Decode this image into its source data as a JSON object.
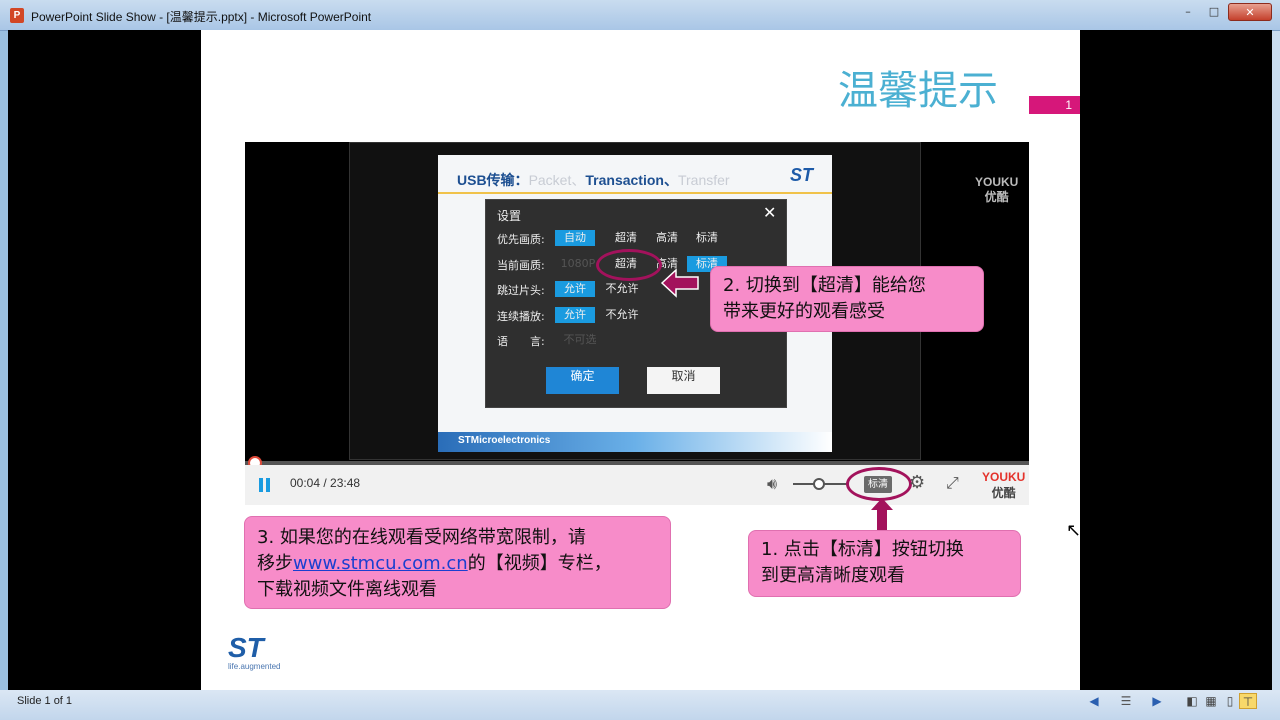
{
  "window": {
    "title": "PowerPoint Slide Show - [温馨提示.pptx] - Microsoft PowerPoint",
    "app_icon": "P",
    "minimize": "–",
    "maximize": "□",
    "close": "✕"
  },
  "slide": {
    "title": "温馨提示",
    "number": "1"
  },
  "video": {
    "inner_heading": {
      "prefix": "USB传输：",
      "packet": "Packet、",
      "transaction": "Transaction、",
      "transfer": "Transfer"
    },
    "inner_footer": "STMicroelectronics",
    "watermark": {
      "line1": "YOUKU",
      "line2": "优酷"
    },
    "dialog": {
      "title": "设置",
      "close": "✕",
      "rows": [
        {
          "label": "优先画质:",
          "options": [
            "自动",
            "超清",
            "高清",
            "标清"
          ],
          "selected": "自动"
        },
        {
          "label": "当前画质:",
          "options": [
            "1080P",
            "超清",
            "高清",
            "标清"
          ],
          "selected": "标清"
        },
        {
          "label": "跳过片头:",
          "options": [
            "允许",
            "不允许"
          ],
          "selected": "允许"
        },
        {
          "label": "连续播放:",
          "options": [
            "允许",
            "不允许"
          ],
          "selected": "允许"
        },
        {
          "label": "语　　言:",
          "options": [
            "不可选"
          ],
          "selected": ""
        }
      ],
      "confirm": "确定",
      "cancel": "取消"
    },
    "controls": {
      "time": "00:04 / 23:48",
      "quality": "标清",
      "progress": 0.003,
      "youku_line1": "YOUKU",
      "youku_line2": "优酷"
    }
  },
  "callouts": {
    "step2": {
      "line1": "2. 切换到【超清】能给您",
      "line2": "带来更好的观看感受"
    },
    "step3": {
      "line1": "3. 如果您的在线观看受网络带宽限制，请",
      "line2_pre": "移步",
      "link": "www.stmcu.com.cn",
      "line2_post": "的【视频】专栏，",
      "line3": "下载视频文件离线观看"
    },
    "step1": {
      "line1": "1. 点击【标清】按钮切换",
      "line2": "到更高清晰度观看"
    }
  },
  "logo": {
    "mark": "ST",
    "tagline": "life.augmented"
  },
  "statusbar": {
    "slide_info": "Slide 1 of 1"
  },
  "colors": {
    "accent": "#d6177a",
    "title": "#4bb0d2",
    "callout": "#f78cc9",
    "arrow": "#a3125c",
    "youku_blue": "#1a9be0"
  }
}
